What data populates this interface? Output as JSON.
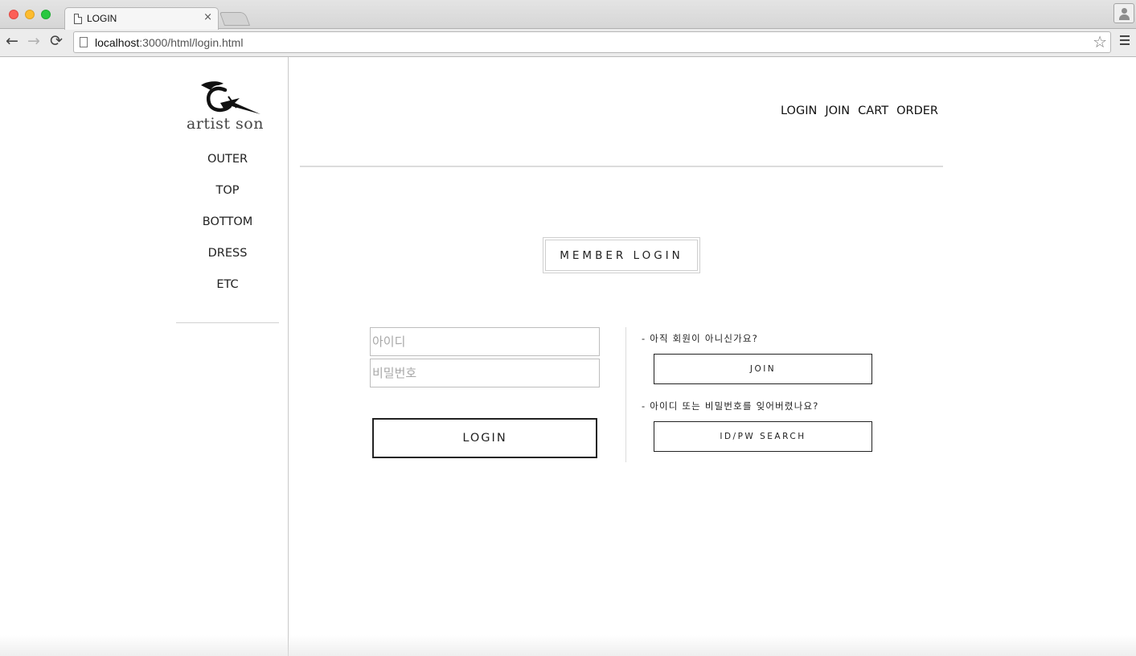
{
  "browser": {
    "tab_title": "LOGIN",
    "tab_close": "×",
    "url_host": "localhost",
    "url_path": ":3000/html/login.html"
  },
  "icons": {
    "back": "arrow-left-icon",
    "forward": "arrow-right-icon",
    "reload": "reload-icon",
    "star": "bookmark-star-icon",
    "menu": "hamburger-menu-icon"
  },
  "brand": {
    "logo_text": "artist son"
  },
  "sidebar": {
    "items": [
      {
        "label": "OUTER"
      },
      {
        "label": "TOP"
      },
      {
        "label": "BOTTOM"
      },
      {
        "label": "DRESS"
      },
      {
        "label": "ETC"
      }
    ]
  },
  "header": {
    "links": [
      {
        "label": "LOGIN"
      },
      {
        "label": "JOIN"
      },
      {
        "label": "CART"
      },
      {
        "label": "ORDER"
      }
    ]
  },
  "login": {
    "title": "MEMBER LOGIN",
    "id_placeholder": "아이디",
    "pw_placeholder": "비밀번호",
    "submit_label": "LOGIN",
    "join_hint": "- 아직 회원이 아니신가요?",
    "join_label": "JOIN",
    "search_hint": "- 아이디 또는 비밀번호를 잊어버렸나요?",
    "search_label": "ID/PW SEARCH"
  }
}
